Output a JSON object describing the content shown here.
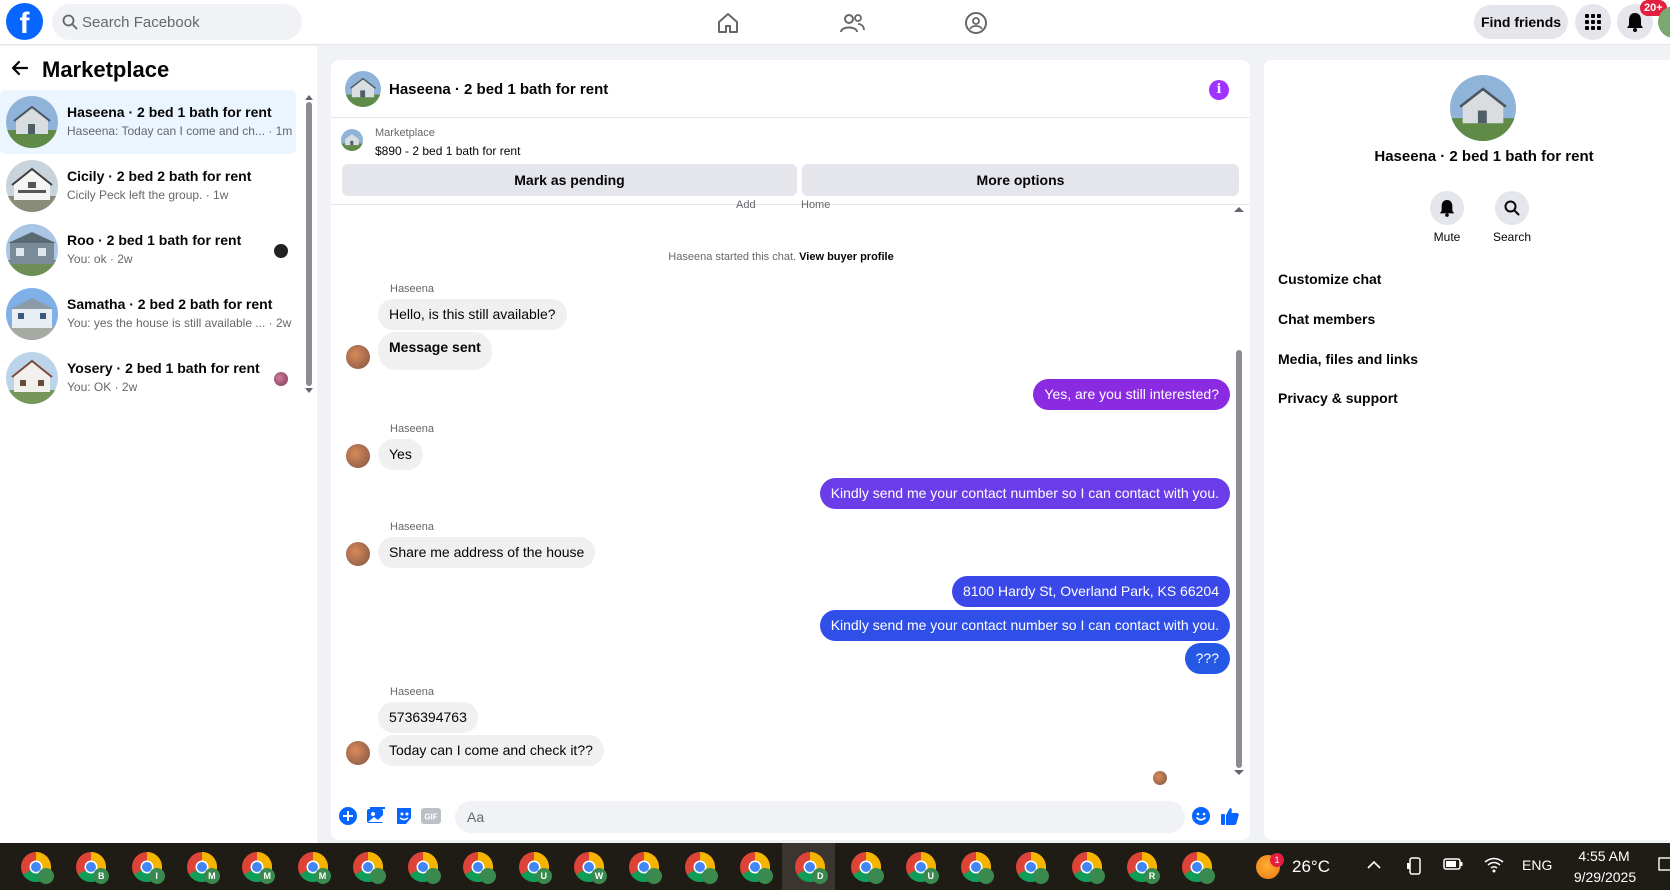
{
  "topbar": {
    "logo_letter": "f",
    "search_placeholder": "Search Facebook",
    "find_friends_label": "Find friends",
    "notification_count": "20+"
  },
  "sidebar": {
    "title": "Marketplace",
    "conversations": [
      {
        "name": "Haseena · 2 bed 1 bath for rent",
        "preview": "Haseena: Today can I come and ch... · 1m",
        "active": true
      },
      {
        "name": "Cicily · 2 bed 2 bath for rent",
        "preview": "Cicily Peck left the group. · 1w",
        "active": false
      },
      {
        "name": "Roo · 2 bed 1 bath for rent",
        "preview": "You: ok · 2w",
        "active": false
      },
      {
        "name": "Samatha · 2 bed 2 bath for rent",
        "preview": "You: yes the house is still available ... · 2w",
        "active": false
      },
      {
        "name": "Yosery · 2 bed 1 bath for rent",
        "preview": "You: OK · 2w",
        "active": false
      }
    ]
  },
  "chat": {
    "title": "Haseena · 2 bed 1 bath for rent",
    "marketplace_label": "Marketplace",
    "listing": "$890 - 2 bed 1 bath for rent",
    "mark_pending_label": "Mark as pending",
    "more_options_label": "More options",
    "cut_text_1": "Add",
    "cut_text_2": "Home",
    "system_text": "Haseena started this chat.",
    "system_link": "View buyer profile",
    "sender_name": "Haseena",
    "messages": [
      {
        "text": "Hello, is this still available?"
      },
      {
        "text": "Message sent"
      },
      {
        "text": "Yes, are you still interested?"
      },
      {
        "text": "Yes"
      },
      {
        "text": "Kindly send me your contact number so I can contact with you."
      },
      {
        "text": "Share me address of the house"
      },
      {
        "text": "8100 Hardy St, Overland Park, KS 66204"
      },
      {
        "text": "Kindly send me your contact number so I can contact with you."
      },
      {
        "text": "???"
      },
      {
        "text": "5736394763"
      },
      {
        "text": "Today can I come and check it??"
      }
    ],
    "composer_placeholder": "Aa",
    "gif_label": "GIF"
  },
  "right_panel": {
    "title": "Haseena · 2 bed 1 bath for rent",
    "mute_label": "Mute",
    "search_label": "Search",
    "menu": [
      "Customize chat",
      "Chat members",
      "Media, files and links",
      "Privacy & support"
    ]
  },
  "taskbar": {
    "app_letters": [
      "",
      "B",
      "I",
      "M",
      "M",
      "M",
      "",
      "",
      "",
      "U",
      "W",
      "",
      "",
      "",
      "D",
      "",
      "U",
      "",
      "",
      "",
      "R",
      ""
    ],
    "weather_badge": "1",
    "temperature": "26°C",
    "language": "ENG",
    "time": "4:55 AM",
    "date": "9/29/2025"
  },
  "colors": {
    "brand_blue": "#0866ff",
    "active_row": "#ebf5ff",
    "bubble_purple": "#8a2be2",
    "bubble_blue": "#2f4fe8",
    "info_purple": "#a033ff"
  }
}
